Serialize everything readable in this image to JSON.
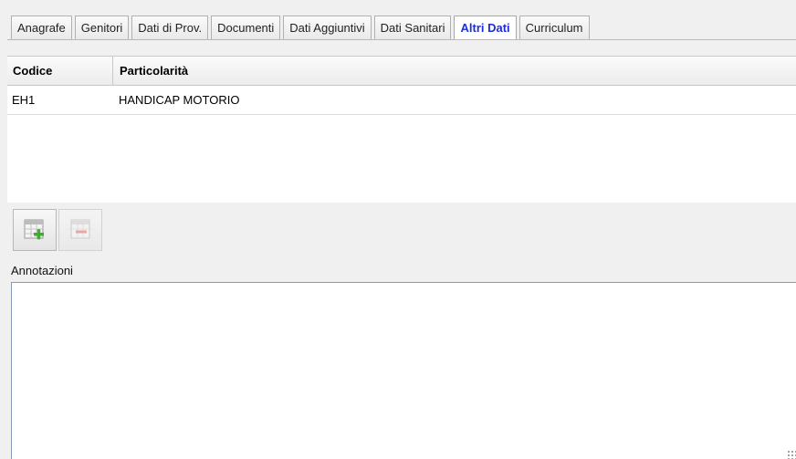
{
  "tabs": [
    {
      "label": "Anagrafe",
      "active": false
    },
    {
      "label": "Genitori",
      "active": false
    },
    {
      "label": "Dati di Prov.",
      "active": false
    },
    {
      "label": "Documenti",
      "active": false
    },
    {
      "label": "Dati Aggiuntivi",
      "active": false
    },
    {
      "label": "Dati Sanitari",
      "active": false
    },
    {
      "label": "Altri Dati",
      "active": true
    },
    {
      "label": "Curriculum",
      "active": false
    }
  ],
  "grid": {
    "columns": [
      "Codice",
      "Particolarità"
    ],
    "rows": [
      [
        "EH1",
        "HANDICAP MOTORIO"
      ]
    ]
  },
  "toolbar": {
    "add_icon": "add-row-icon",
    "remove_icon": "remove-row-icon"
  },
  "annotations": {
    "label": "Annotazioni",
    "value": ""
  },
  "colors": {
    "active_tab_text": "#1e2fd6",
    "textarea_border": "#7f9db9"
  }
}
